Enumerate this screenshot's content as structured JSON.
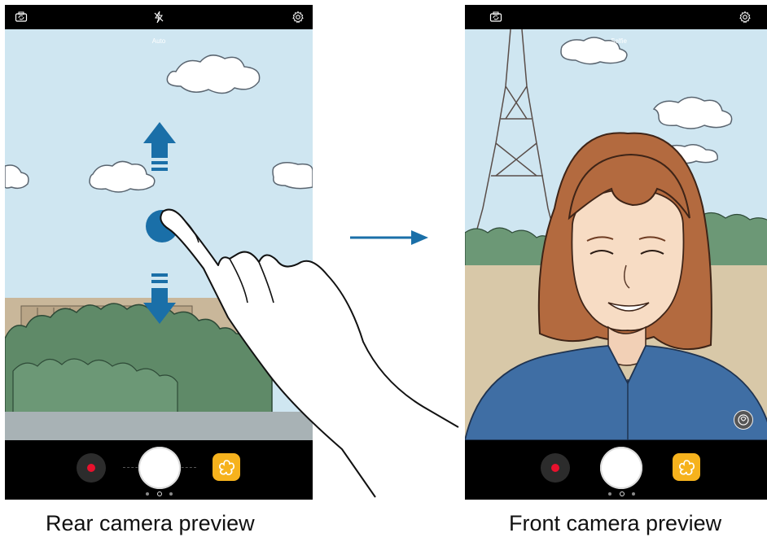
{
  "left_screen": {
    "mode_label": "Auto",
    "icons": {
      "switch": "switch-camera-icon",
      "flash": "flash-off-icon",
      "settings": "gear-icon"
    }
  },
  "right_screen": {
    "mode_label": "Selfie",
    "icons": {
      "switch": "switch-camera-icon",
      "settings": "gear-icon",
      "beauty": "beauty-icon"
    }
  },
  "bottom_controls": {
    "record": "record-icon",
    "shutter": "shutter-button",
    "effects": "effects-icon"
  },
  "captions": {
    "left": "Rear camera preview",
    "right": "Front camera preview"
  },
  "colors": {
    "arrow_blue": "#1a6fa8",
    "accent_orange": "#f6b21d",
    "record_red": "#e8112d",
    "sky": "#cfe6f1"
  }
}
